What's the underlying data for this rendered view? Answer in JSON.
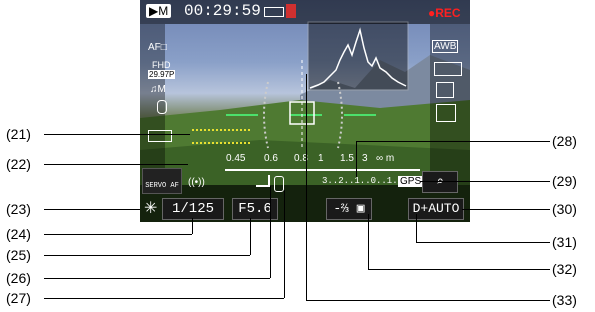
{
  "top": {
    "mode": "M",
    "timecode": "00:29:59",
    "rec": "●REC"
  },
  "left_icons": {
    "af": "AF□",
    "movie_size": "FHD",
    "frame_rate": "29.97P",
    "mode_m": "M"
  },
  "right_icons": {
    "awb": "AWB"
  },
  "focus_scale": [
    "0.45",
    "0.6",
    "0.8",
    "1",
    "1.5",
    "3",
    "∞ m"
  ],
  "exposure_scale": "3..2..1..0..1..2.:3",
  "servo_af": "SERVO AF",
  "gps": "GPS",
  "shutter": "1/125",
  "aperture": "F5.6",
  "exposure_comp": "-⅔",
  "iso": "AUTO",
  "star": "✳",
  "wireless": "((•))",
  "labels_left": [
    "(21)",
    "(22)",
    "(23)",
    "(24)",
    "(25)",
    "(26)",
    "(27)"
  ],
  "labels_right": [
    "(28)",
    "(29)",
    "(30)",
    "(31)",
    "(32)",
    "(33)"
  ]
}
